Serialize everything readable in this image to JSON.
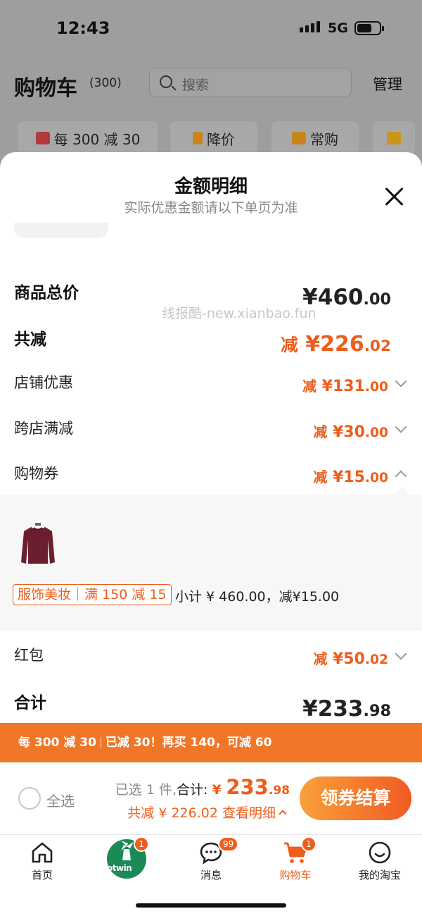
{
  "status_bar": {
    "time": "12:43",
    "network": "5G"
  },
  "cart_header": {
    "title": "购物车",
    "count": "(300)",
    "search_placeholder": "搜索",
    "manage": "管理"
  },
  "filter_chips": [
    {
      "label": "每 300 减 30",
      "icon": "gift-icon"
    },
    {
      "label": "降价",
      "icon": "down-arrow-icon"
    },
    {
      "label": "常购",
      "icon": "cart-icon"
    },
    {
      "label": "",
      "icon": "folder-icon"
    }
  ],
  "sheet": {
    "title": "金额明细",
    "subtitle": "实际优惠金额请以下单页为准",
    "watermark": "线报酷-new.xianbao.fun",
    "rows": {
      "total_price": {
        "label": "商品总价",
        "currency": "¥",
        "int": "460",
        "dec": ".00"
      },
      "total_discount": {
        "label": "共减",
        "prefix": "减",
        "currency": "¥",
        "int": "226",
        "dec": ".02"
      },
      "shop_discount": {
        "label": "店铺优惠",
        "prefix": "减",
        "currency": "¥",
        "int": "131",
        "dec": ".00"
      },
      "cross_shop": {
        "label": "跨店满减",
        "prefix": "减",
        "currency": "¥",
        "int": "30",
        "dec": ".00"
      },
      "voucher": {
        "label": "购物券",
        "prefix": "减",
        "currency": "¥",
        "int": "15",
        "dec": ".00"
      },
      "red_packet": {
        "label": "红包",
        "prefix": "减",
        "currency": "¥",
        "int": "50",
        "dec": ".02"
      },
      "grand_total": {
        "label": "合计",
        "currency": "¥",
        "int": "233",
        "dec": ".98"
      }
    },
    "voucher_detail": {
      "tag": "服饰美妆｜满 150 减 15",
      "subtotal": "小计 ¥ 460.00，减¥15.00"
    }
  },
  "promo_bar": {
    "part1": "每 300 减 30",
    "part2": "已减 30！再买 140，可减 60"
  },
  "checkout": {
    "select_all": "全选",
    "selected": "已选 1 件,",
    "total_label": "合计:",
    "currency": "¥",
    "int": "233",
    "dec": ".98",
    "discount_line": "共减 ¥ 226.02  查看明细",
    "button": "领券结算"
  },
  "tabbar": [
    {
      "label": "首页",
      "icon": "home-icon"
    },
    {
      "label": "",
      "icon": "hotwind-logo",
      "logo_text": "otwin",
      "badge": "1"
    },
    {
      "label": "消息",
      "icon": "message-icon",
      "badge": "99"
    },
    {
      "label": "购物车",
      "icon": "cart-icon",
      "badge": "1",
      "active": true
    },
    {
      "label": "我的淘宝",
      "icon": "profile-smile-icon"
    }
  ],
  "colors": {
    "accent": "#ee5d1b",
    "promo_bar": "#f07628",
    "overlay": "#9e9e9e"
  }
}
